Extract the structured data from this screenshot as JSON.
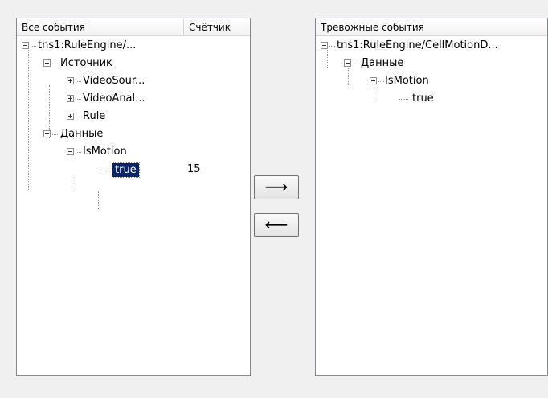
{
  "left_panel": {
    "col_events": "Все события",
    "col_counter": "Счётчик",
    "nodes": {
      "root": "tns1:RuleEngine/...",
      "source": "Источник",
      "videosource": "VideoSour...",
      "videoanalytics": "VideoAnal...",
      "rule": "Rule",
      "data": "Данные",
      "ismotion": "IsMotion",
      "true": "true",
      "true_count": "15"
    }
  },
  "right_panel": {
    "col_alarm": "Тревожные события",
    "nodes": {
      "root": "tns1:RuleEngine/CellMotionD...",
      "data": "Данные",
      "ismotion": "IsMotion",
      "true": "true"
    }
  },
  "buttons": {
    "add_arrow": "⟶",
    "remove_arrow": "⟵"
  },
  "icons": {
    "expanded": "minus-box-icon",
    "collapsed": "plus-box-icon"
  }
}
